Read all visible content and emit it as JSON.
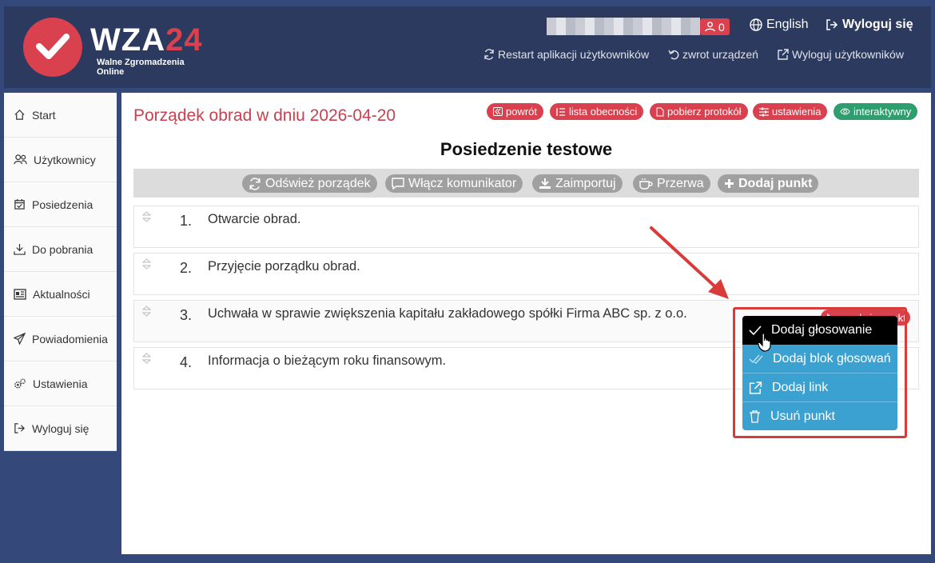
{
  "logo": {
    "brand": "WZA",
    "brand_num": "24",
    "tagline": "Walne Zgromadzenia Online"
  },
  "header": {
    "notif_count": "0",
    "language": "English",
    "logout": "Wyloguj się",
    "restart_apps": "Restart aplikacji użytkowników",
    "device_return": "zwrot urządzeń",
    "logout_users": "Wyloguj użytkowników"
  },
  "sidebar": {
    "items": [
      {
        "label": "Start",
        "icon": "home-icon"
      },
      {
        "label": "Użytkownicy",
        "icon": "users-icon"
      },
      {
        "label": "Posiedzenia",
        "icon": "calendar-icon"
      },
      {
        "label": "Do pobrania",
        "icon": "download-icon"
      },
      {
        "label": "Aktualności",
        "icon": "news-icon"
      },
      {
        "label": "Powiadomienia",
        "icon": "paper-plane-icon"
      },
      {
        "label": "Ustawienia",
        "icon": "gears-icon"
      },
      {
        "label": "Wyloguj się",
        "icon": "logout-icon"
      }
    ]
  },
  "main": {
    "title": "Porządek obrad w dniu 2026-04-20",
    "pills": {
      "back": "powrót",
      "attendance": "lista obecności",
      "protocol": "pobierz protokół",
      "settings": "ustawienia",
      "interactive": "interaktywny"
    },
    "meeting_name": "Posiedzenie testowe",
    "toolbar": {
      "refresh": "Odśwież porządek",
      "chat": "Włącz komunikator",
      "import": "Zaimportuj",
      "break": "Przerwa",
      "add_item": "Dodaj punkt"
    },
    "agenda": [
      {
        "num": "1.",
        "text": "Otwarcie obrad."
      },
      {
        "num": "2.",
        "text": "Przyjęcie porządku obrad."
      },
      {
        "num": "3.",
        "text": "Uchwała w sprawie zwiększenia kapitału zakładowego spółki Firma ABC sp. z o.o."
      },
      {
        "num": "4.",
        "text": "Informacja o bieżącym roku finansowym."
      }
    ],
    "item_button_partial": "akcje punkt"
  },
  "dropdown": {
    "items": [
      "Dodaj głosowanie",
      "Dodaj blok głosowań",
      "Dodaj link",
      "Usuń punkt"
    ]
  },
  "colors": {
    "accent": "#d9414f",
    "header": "#2b3a5e",
    "dropdown": "#3aa1d1",
    "green": "#2e9e6e"
  }
}
